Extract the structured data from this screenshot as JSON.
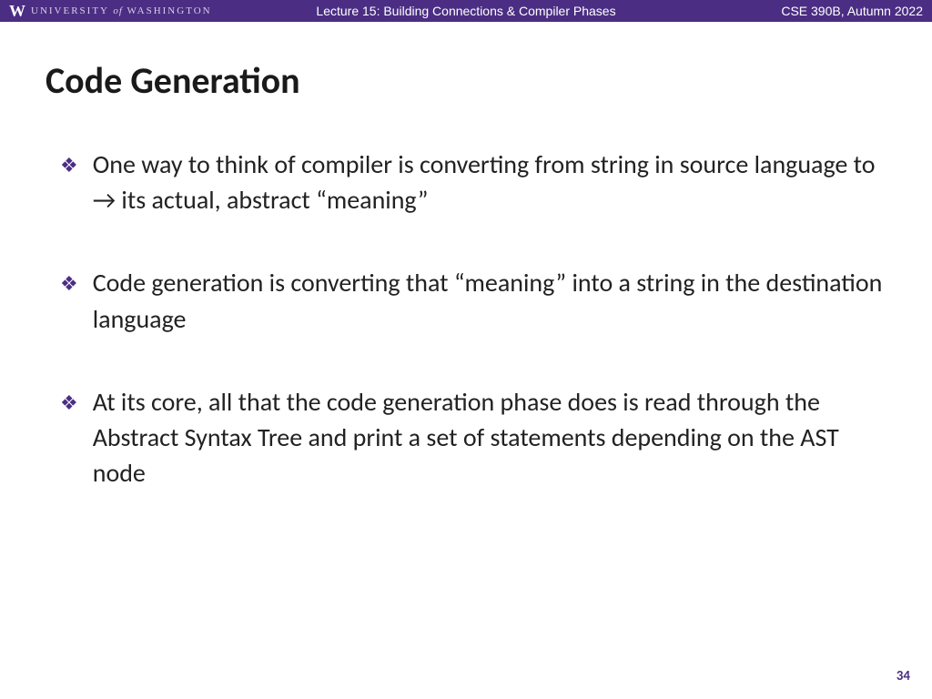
{
  "header": {
    "university_prefix": "UNIVERSITY",
    "university_of": "of",
    "university_suffix": "WASHINGTON",
    "lecture_title": "Lecture 15: Building Connections & Compiler Phases",
    "course_info": "CSE 390B, Autumn 2022"
  },
  "slide": {
    "title": "Code Generation",
    "bullets": [
      "One way to think of compiler is converting from string in source language to → its actual, abstract “meaning”",
      "Code generation is converting that “meaning” into a string in the destination language",
      "At its core, all that the code generation phase does is read through the Abstract Syntax Tree and print a set of statements depending on the AST node"
    ]
  },
  "page_number": "34"
}
